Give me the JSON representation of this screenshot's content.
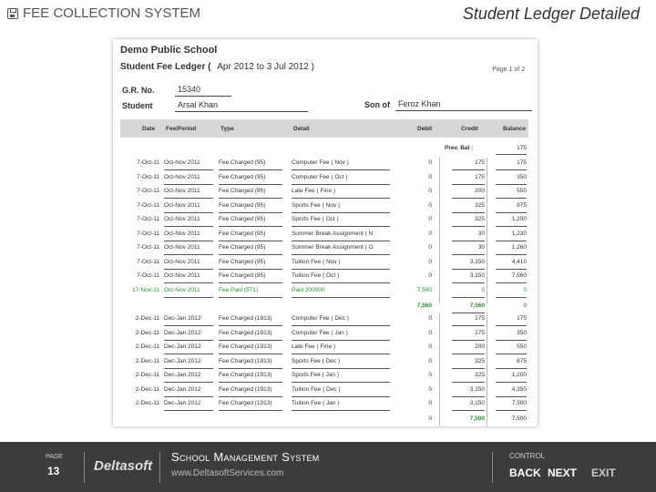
{
  "header": {
    "app_title": "FEE COLLECTION SYSTEM",
    "slide_title": "Student Ledger Detailed"
  },
  "document": {
    "school": "Demo Public School",
    "ledger_title": "Student Fee Ledger (",
    "ledger_range": "Apr 2012 to 3 Jul 2012 )",
    "page": "Page 1 of 2",
    "gr_label": "G.R. No.",
    "gr_value": "15340",
    "student_label": "Student",
    "student_value": "Arsal Khan",
    "son_of_label": "Son of",
    "son_of_value": "Feroz Khan",
    "columns": [
      "Date",
      "Fee/Period",
      "Type",
      "Detail",
      "Debit",
      "Credit",
      "Balance"
    ],
    "prev_bal_label": "Prev. Bal :",
    "prev_bal_value": "175",
    "rows": [
      {
        "date": "7-Oct-11",
        "period": "Oct-Nov 2011",
        "type": "Fee Charged (95)",
        "detail": "Computer Fee ( Nov )",
        "debit": "0",
        "credit": "175",
        "balance": "175"
      },
      {
        "date": "7-Oct-11",
        "period": "Oct-Nov 2011",
        "type": "Fee Charged (95)",
        "detail": "Computer Fee ( Oct )",
        "debit": "0",
        "credit": "175",
        "balance": "350"
      },
      {
        "date": "7-Oct-11",
        "period": "Oct-Nov 2011",
        "type": "Fee Charged (95)",
        "detail": "Late Fee ( Fine )",
        "debit": "0",
        "credit": "200",
        "balance": "550"
      },
      {
        "date": "7-Oct-11",
        "period": "Oct-Nov 2011",
        "type": "Fee Charged (95)",
        "detail": "Sports Fee ( Nov )",
        "debit": "0",
        "credit": "325",
        "balance": "875"
      },
      {
        "date": "7-Oct-11",
        "period": "Oct-Nov 2011",
        "type": "Fee Charged (95)",
        "detail": "Sports Fee ( Oct )",
        "debit": "0",
        "credit": "325",
        "balance": "1,200"
      },
      {
        "date": "7-Oct-11",
        "period": "Oct-Nov 2011",
        "type": "Fee Charged (95)",
        "detail": "Summer Break Assignment ( N",
        "debit": "0",
        "credit": "30",
        "balance": "1,230"
      },
      {
        "date": "7-Oct-11",
        "period": "Oct-Nov 2011",
        "type": "Fee Charged (95)",
        "detail": "Summer Break Assignment ( O",
        "debit": "0",
        "credit": "30",
        "balance": "1,260"
      },
      {
        "date": "7-Oct-11",
        "period": "Oct-Nov 2011",
        "type": "Fee Charged (95)",
        "detail": "Tuition Fee ( Nov )",
        "debit": "0",
        "credit": "3,150",
        "balance": "4,410"
      },
      {
        "date": "7-Oct-11",
        "period": "Oct-Nov 2011",
        "type": "Fee Charged (95)",
        "detail": "Tuition Fee ( Oct )",
        "debit": "0",
        "credit": "3,150",
        "balance": "7,560"
      },
      {
        "date": "17-Nov-11",
        "period": "Oct-Nov 2011",
        "type": "Fee Paid (571)",
        "detail": "Paid 200000",
        "debit": "7,560",
        "credit": "0",
        "balance": "0",
        "paid": true
      }
    ],
    "subtotal_debit": "7,560",
    "subtotal_credit": "7,560",
    "subtotal_balance": "0",
    "rows2": [
      {
        "date": "2-Dec-11",
        "period": "Dec-Jan 2012",
        "type": "Fee Charged (1913)",
        "detail": "Computer Fee ( Dec )",
        "debit": "0",
        "credit": "175",
        "balance": "175"
      },
      {
        "date": "2-Dec-11",
        "period": "Dec-Jan 2012",
        "type": "Fee Charged (1913)",
        "detail": "Computer Fee ( Jan )",
        "debit": "0",
        "credit": "175",
        "balance": "350"
      },
      {
        "date": "2-Dec-11",
        "period": "Dec-Jan 2012",
        "type": "Fee Charged (1913)",
        "detail": "Late Fee ( Fine )",
        "debit": "0",
        "credit": "200",
        "balance": "550"
      },
      {
        "date": "2-Dec-11",
        "period": "Dec-Jan 2012",
        "type": "Fee Charged (1913)",
        "detail": "Sports Fee ( Dec )",
        "debit": "0",
        "credit": "325",
        "balance": "875"
      },
      {
        "date": "2-Dec-11",
        "period": "Dec-Jan 2012",
        "type": "Fee Charged (1913)",
        "detail": "Sports Fee ( Jan )",
        "debit": "0",
        "credit": "325",
        "balance": "1,200"
      },
      {
        "date": "2-Dec-11",
        "period": "Dec-Jan 2012",
        "type": "Fee Charged (1913)",
        "detail": "Tuition Fee ( Dec )",
        "debit": "0",
        "credit": "3,150",
        "balance": "4,350"
      },
      {
        "date": "2-Dec-11",
        "period": "Dec-Jan 2012",
        "type": "Fee Charged (1913)",
        "detail": "Tuition Fee ( Jan )",
        "debit": "0",
        "credit": "3,150",
        "balance": "7,500"
      }
    ],
    "total_debit": "0",
    "total_credit": "7,500",
    "total_balance": "7,500"
  },
  "footer": {
    "page_label": "PAGE",
    "page_number": "13",
    "brand": "Deltasoft",
    "system_name": "School Management System",
    "url": "www.DeltasoftServices.com",
    "control_label": "CONTROL",
    "back": "BACK",
    "next": "NEXT",
    "exit": "EXIT"
  }
}
